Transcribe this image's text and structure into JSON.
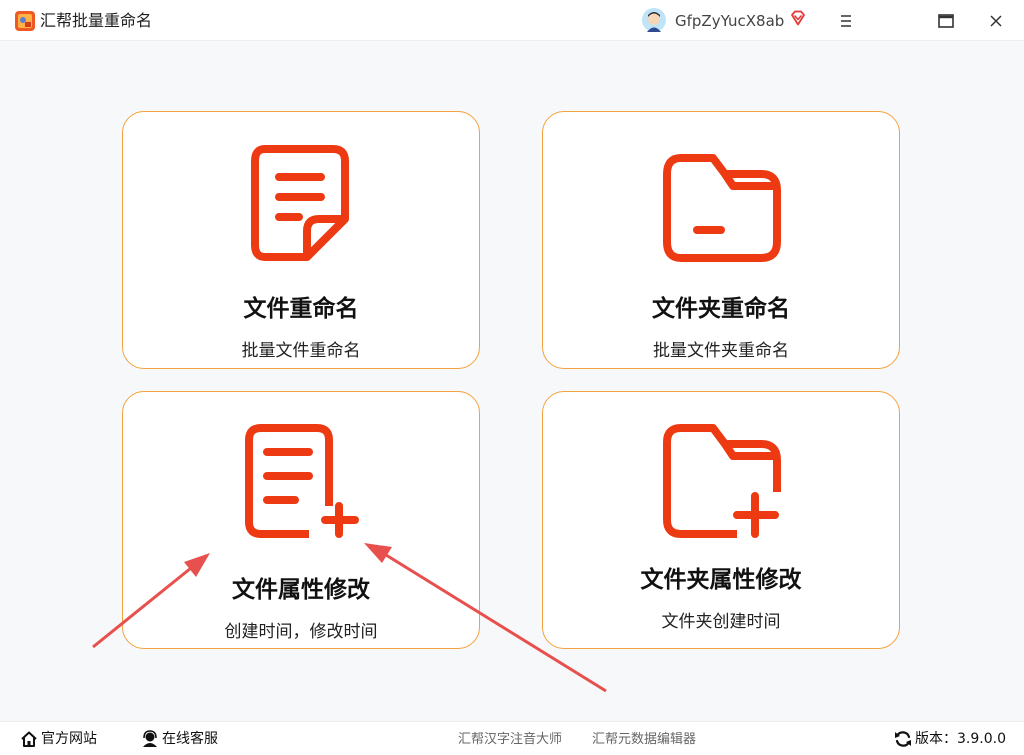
{
  "window": {
    "title": "汇帮批量重命名",
    "username": "GfpZyYucX8ab"
  },
  "colors": {
    "accent": "#ee3a12",
    "card_border": "#f2a23f",
    "annotation_arrow": "#e8504d"
  },
  "cards": [
    {
      "title": "文件重命名",
      "desc": "批量文件重命名",
      "icon": "document-icon"
    },
    {
      "title": "文件夹重命名",
      "desc": "批量文件夹重命名",
      "icon": "folder-icon"
    },
    {
      "title": "文件属性修改",
      "desc": "创建时间，修改时间",
      "icon": "document-add-icon"
    },
    {
      "title": "文件夹属性修改",
      "desc": "文件夹创建时间",
      "icon": "folder-add-icon"
    }
  ],
  "footer": {
    "website": "官方网站",
    "support": "在线客服",
    "link1": "汇帮汉字注音大师",
    "link2": "汇帮元数据编辑器",
    "version": "版本：3.9.0.0"
  }
}
